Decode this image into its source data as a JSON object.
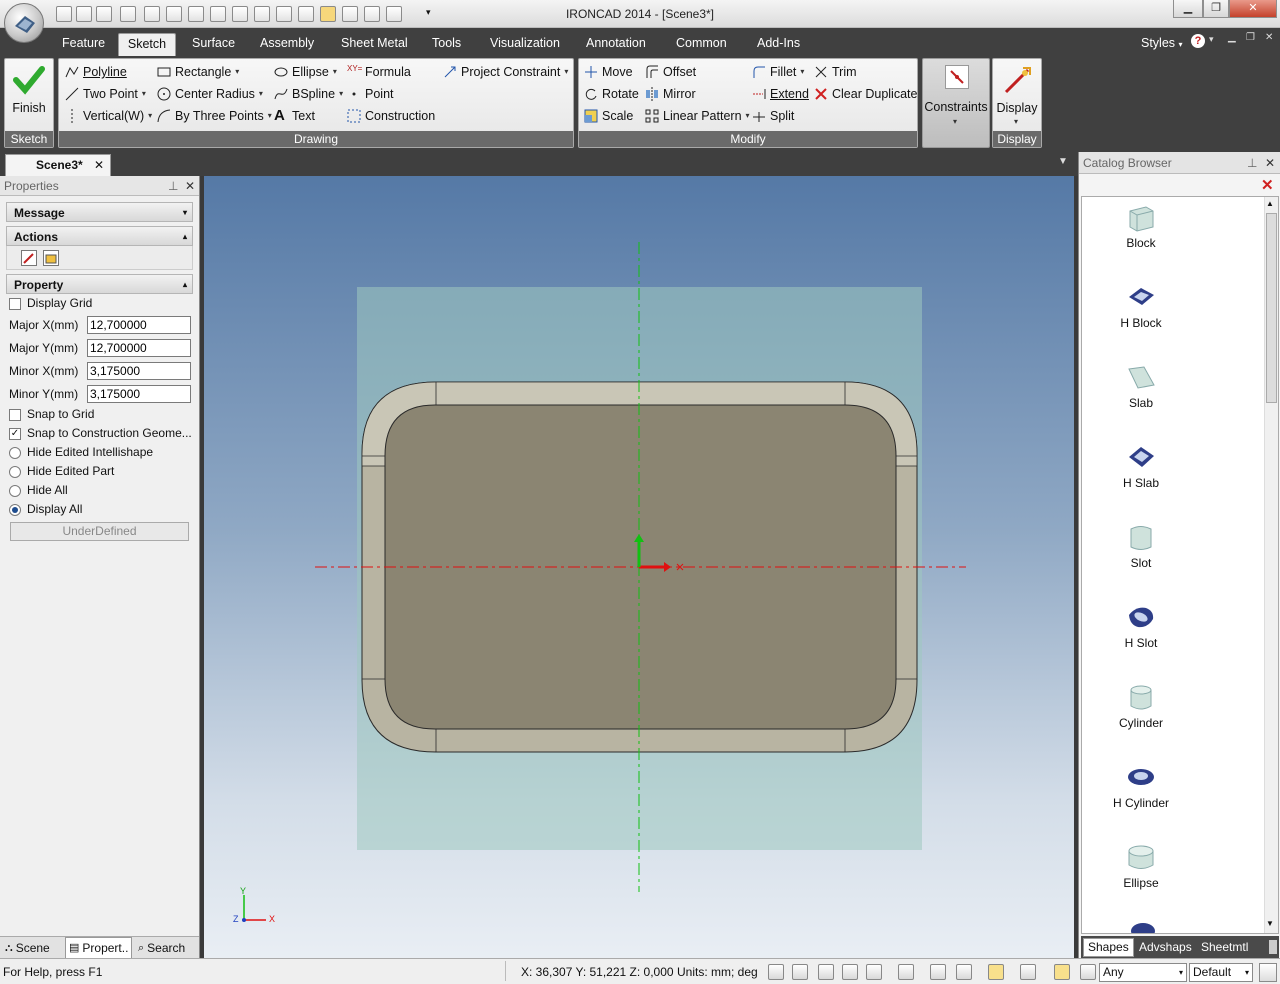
{
  "window": {
    "title": "IRONCAD 2014 - [Scene3*]"
  },
  "ribbon_tabs": [
    "Feature",
    "Sketch",
    "Surface",
    "Assembly",
    "Sheet Metal",
    "Tools",
    "Visualization",
    "Annotation",
    "Common",
    "Add-Ins"
  ],
  "styles_label": "Styles",
  "ribbon": {
    "finish_label": "Finish",
    "groups": {
      "sketch": "Sketch",
      "drawing": "Drawing",
      "modify": "Modify",
      "display": "Display"
    },
    "drawing": {
      "polyline": "Polyline",
      "two_point": "Two Point",
      "vertical": "Vertical(W)",
      "rectangle": "Rectangle",
      "center_radius": "Center Radius",
      "by_three_points": "By Three Points",
      "ellipse": "Ellipse",
      "bspline": "BSpline",
      "text": "Text",
      "formula": "Formula",
      "point": "Point",
      "construction": "Construction",
      "project_constraint": "Project Constraint"
    },
    "modify": {
      "move": "Move",
      "rotate": "Rotate",
      "scale": "Scale",
      "offset": "Offset",
      "mirror": "Mirror",
      "linear_pattern": "Linear Pattern",
      "fillet": "Fillet",
      "extend": "Extend",
      "split": "Split",
      "trim": "Trim",
      "clear_duplicate": "Clear Duplicate"
    },
    "constraints_label": "Constraints",
    "display_label": "Display"
  },
  "document_tab": "Scene3*",
  "properties": {
    "title": "Properties",
    "message_label": "Message",
    "actions_label": "Actions",
    "property_label": "Property",
    "display_grid": {
      "label": "Display Grid",
      "checked": false
    },
    "major_x": {
      "label": "Major X(mm)",
      "value": "12,700000"
    },
    "major_y": {
      "label": "Major Y(mm)",
      "value": "12,700000"
    },
    "minor_x": {
      "label": "Minor X(mm)",
      "value": "3,175000"
    },
    "minor_y": {
      "label": "Minor Y(mm)",
      "value": "3,175000"
    },
    "snap_to_grid": {
      "label": "Snap to Grid",
      "checked": false
    },
    "snap_construction": {
      "label": "Snap to Construction Geome...",
      "checked": true
    },
    "radios": [
      "Hide Edited Intellishape",
      "Hide Edited Part",
      "Hide All",
      "Display All"
    ],
    "radio_selected": "Display All",
    "status_button": "UnderDefined",
    "bottom_tabs": [
      "Scene",
      "Propert..",
      "Search"
    ]
  },
  "viewport": {
    "triad": {
      "y": "Y",
      "z": "Z",
      "x": "X"
    },
    "colors": {
      "part_face": "#8b8572",
      "axis_h": "#e01010",
      "axis_v": "#12c012",
      "sketch_plane": "#9fc8c0"
    }
  },
  "catalog": {
    "title": "Catalog Browser",
    "items": [
      "Block",
      "H Block",
      "Slab",
      "H Slab",
      "Slot",
      "H Slot",
      "Cylinder",
      "H Cylinder",
      "Ellipse"
    ],
    "tabs": [
      "Shapes",
      "Advshaps",
      "Sheetmtl"
    ]
  },
  "status": {
    "help": "For Help, press F1",
    "coords": "X: 36,307 Y: 51,221 Z: 0,000",
    "units": "Units: mm; deg",
    "filter": "Any",
    "style": "Default"
  }
}
